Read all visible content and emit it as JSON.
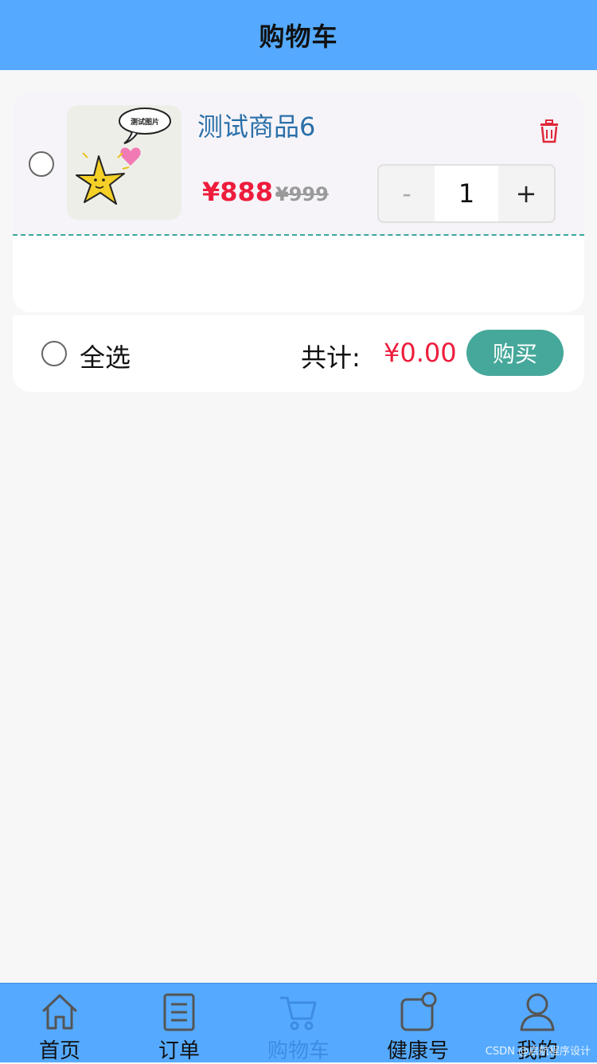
{
  "header": {
    "title": "购物车"
  },
  "cart": {
    "items": [
      {
        "name": "测试商品6",
        "image_caption": "测试图片",
        "price": "¥888",
        "original_price": "¥999",
        "quantity": "1",
        "minus_label": "-",
        "plus_label": "+",
        "selected": false
      }
    ]
  },
  "footer": {
    "select_all_label": "全选",
    "total_label": "共计:",
    "total_value": "¥0.00",
    "buy_label": "购买"
  },
  "tabbar": {
    "tabs": [
      {
        "label": "首页",
        "icon": "home-icon",
        "active": false
      },
      {
        "label": "订单",
        "icon": "order-icon",
        "active": false
      },
      {
        "label": "购物车",
        "icon": "cart-icon",
        "active": true
      },
      {
        "label": "健康号",
        "icon": "health-icon",
        "active": false
      },
      {
        "label": "我的",
        "icon": "user-icon",
        "active": false
      }
    ]
  },
  "watermark": "CSDN @启航程序设计",
  "colors": {
    "header_bg": "#55aaff",
    "price": "#ee1c3c",
    "buy_button": "#46a89a",
    "active_tab": "#3d8be5",
    "goods_name": "#2a6fa8"
  }
}
